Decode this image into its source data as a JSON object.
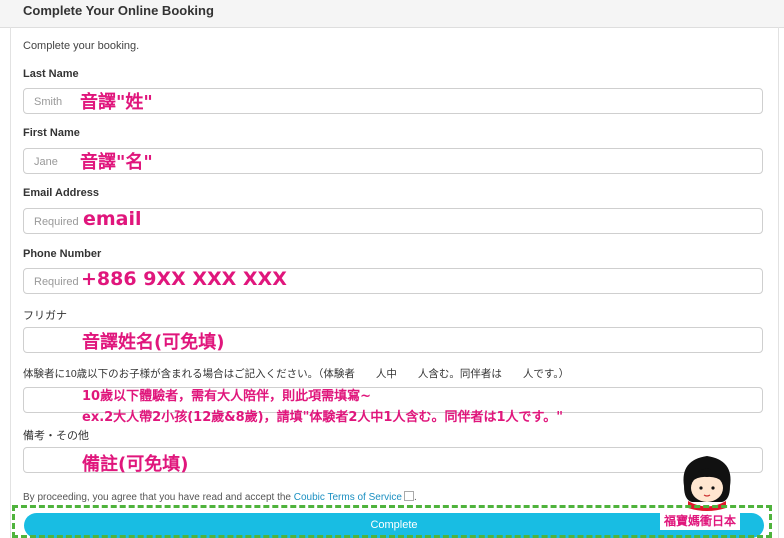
{
  "header": {
    "title": "Complete Your Online Booking"
  },
  "intro": "Complete your booking.",
  "fields": {
    "last_name": {
      "label": "Last Name",
      "placeholder": "Smith",
      "annotation": "音譯\"姓\""
    },
    "first_name": {
      "label": "First Name",
      "placeholder": "Jane",
      "annotation": "音譯\"名\""
    },
    "email": {
      "label": "Email Address",
      "placeholder": "Required",
      "annotation": "email"
    },
    "phone": {
      "label": "Phone Number",
      "placeholder": "Required",
      "annotation": "+886 9XX XXX XXX"
    },
    "furigana": {
      "label": "フリガナ",
      "placeholder": "",
      "annotation": "音譯姓名(可免填)"
    },
    "participants": {
      "label": "体験者に10歳以下のお子様が含まれる場合はご記入ください。（体験者　　人中　　人含む。同伴者は　　人です。）",
      "placeholder": "",
      "annotation_line1": "10歲以下體驗者，需有大人陪伴，則此項需填寫~",
      "annotation_line2": "ex.2大人帶2小孩(12歲&8歲)，請填\"体験者2人中1人含む。同伴者は1人です。\""
    },
    "notes": {
      "label": "備考・その他",
      "placeholder": "",
      "annotation": "備註(可免填)"
    }
  },
  "terms": {
    "prefix": "By proceeding, you agree that you have read and accept the ",
    "link": "Coubic Terms of Service",
    "suffix": "."
  },
  "complete_button": "Complete",
  "brand_label": "福寶媽衝日本",
  "colors": {
    "accent": "#18bde3",
    "annotation": "#e0167c",
    "dash": "#4fb33c"
  }
}
